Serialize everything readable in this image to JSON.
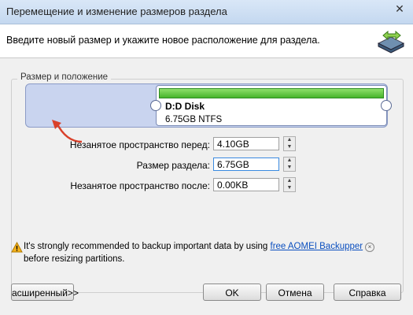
{
  "window": {
    "title": "Перемещение и изменение размеров раздела",
    "subtitle": "Введите новый размер и укажите новое расположение для раздела.",
    "close_glyph": "✕"
  },
  "group": {
    "label": "Размер и положение"
  },
  "partition": {
    "name": "D:D Disk",
    "info": "6.75GB NTFS"
  },
  "fields": [
    {
      "label": "Незанятое пространство перед:",
      "value": "4.10GB"
    },
    {
      "label": "Размер раздела:",
      "value": "6.75GB"
    },
    {
      "label": "Незанятое пространство после:",
      "value": "0.00KB"
    }
  ],
  "warning": {
    "text_before": "It's strongly recommended to backup important data by using ",
    "link": "free AOMEI Backupper",
    "text_after": " before resizing partitions."
  },
  "buttons": {
    "advanced": "асширенный>>",
    "ok": "OK",
    "cancel": "Отмена",
    "help": "Справка"
  },
  "colors": {
    "accent_green": "#46b42c",
    "disk_fill": "#c9d4ef",
    "arrow_red": "#d9402a",
    "link_blue": "#0b4fbf"
  },
  "icons": {
    "header": "partition-resize-icon",
    "warning": "warning-triangle-icon"
  }
}
